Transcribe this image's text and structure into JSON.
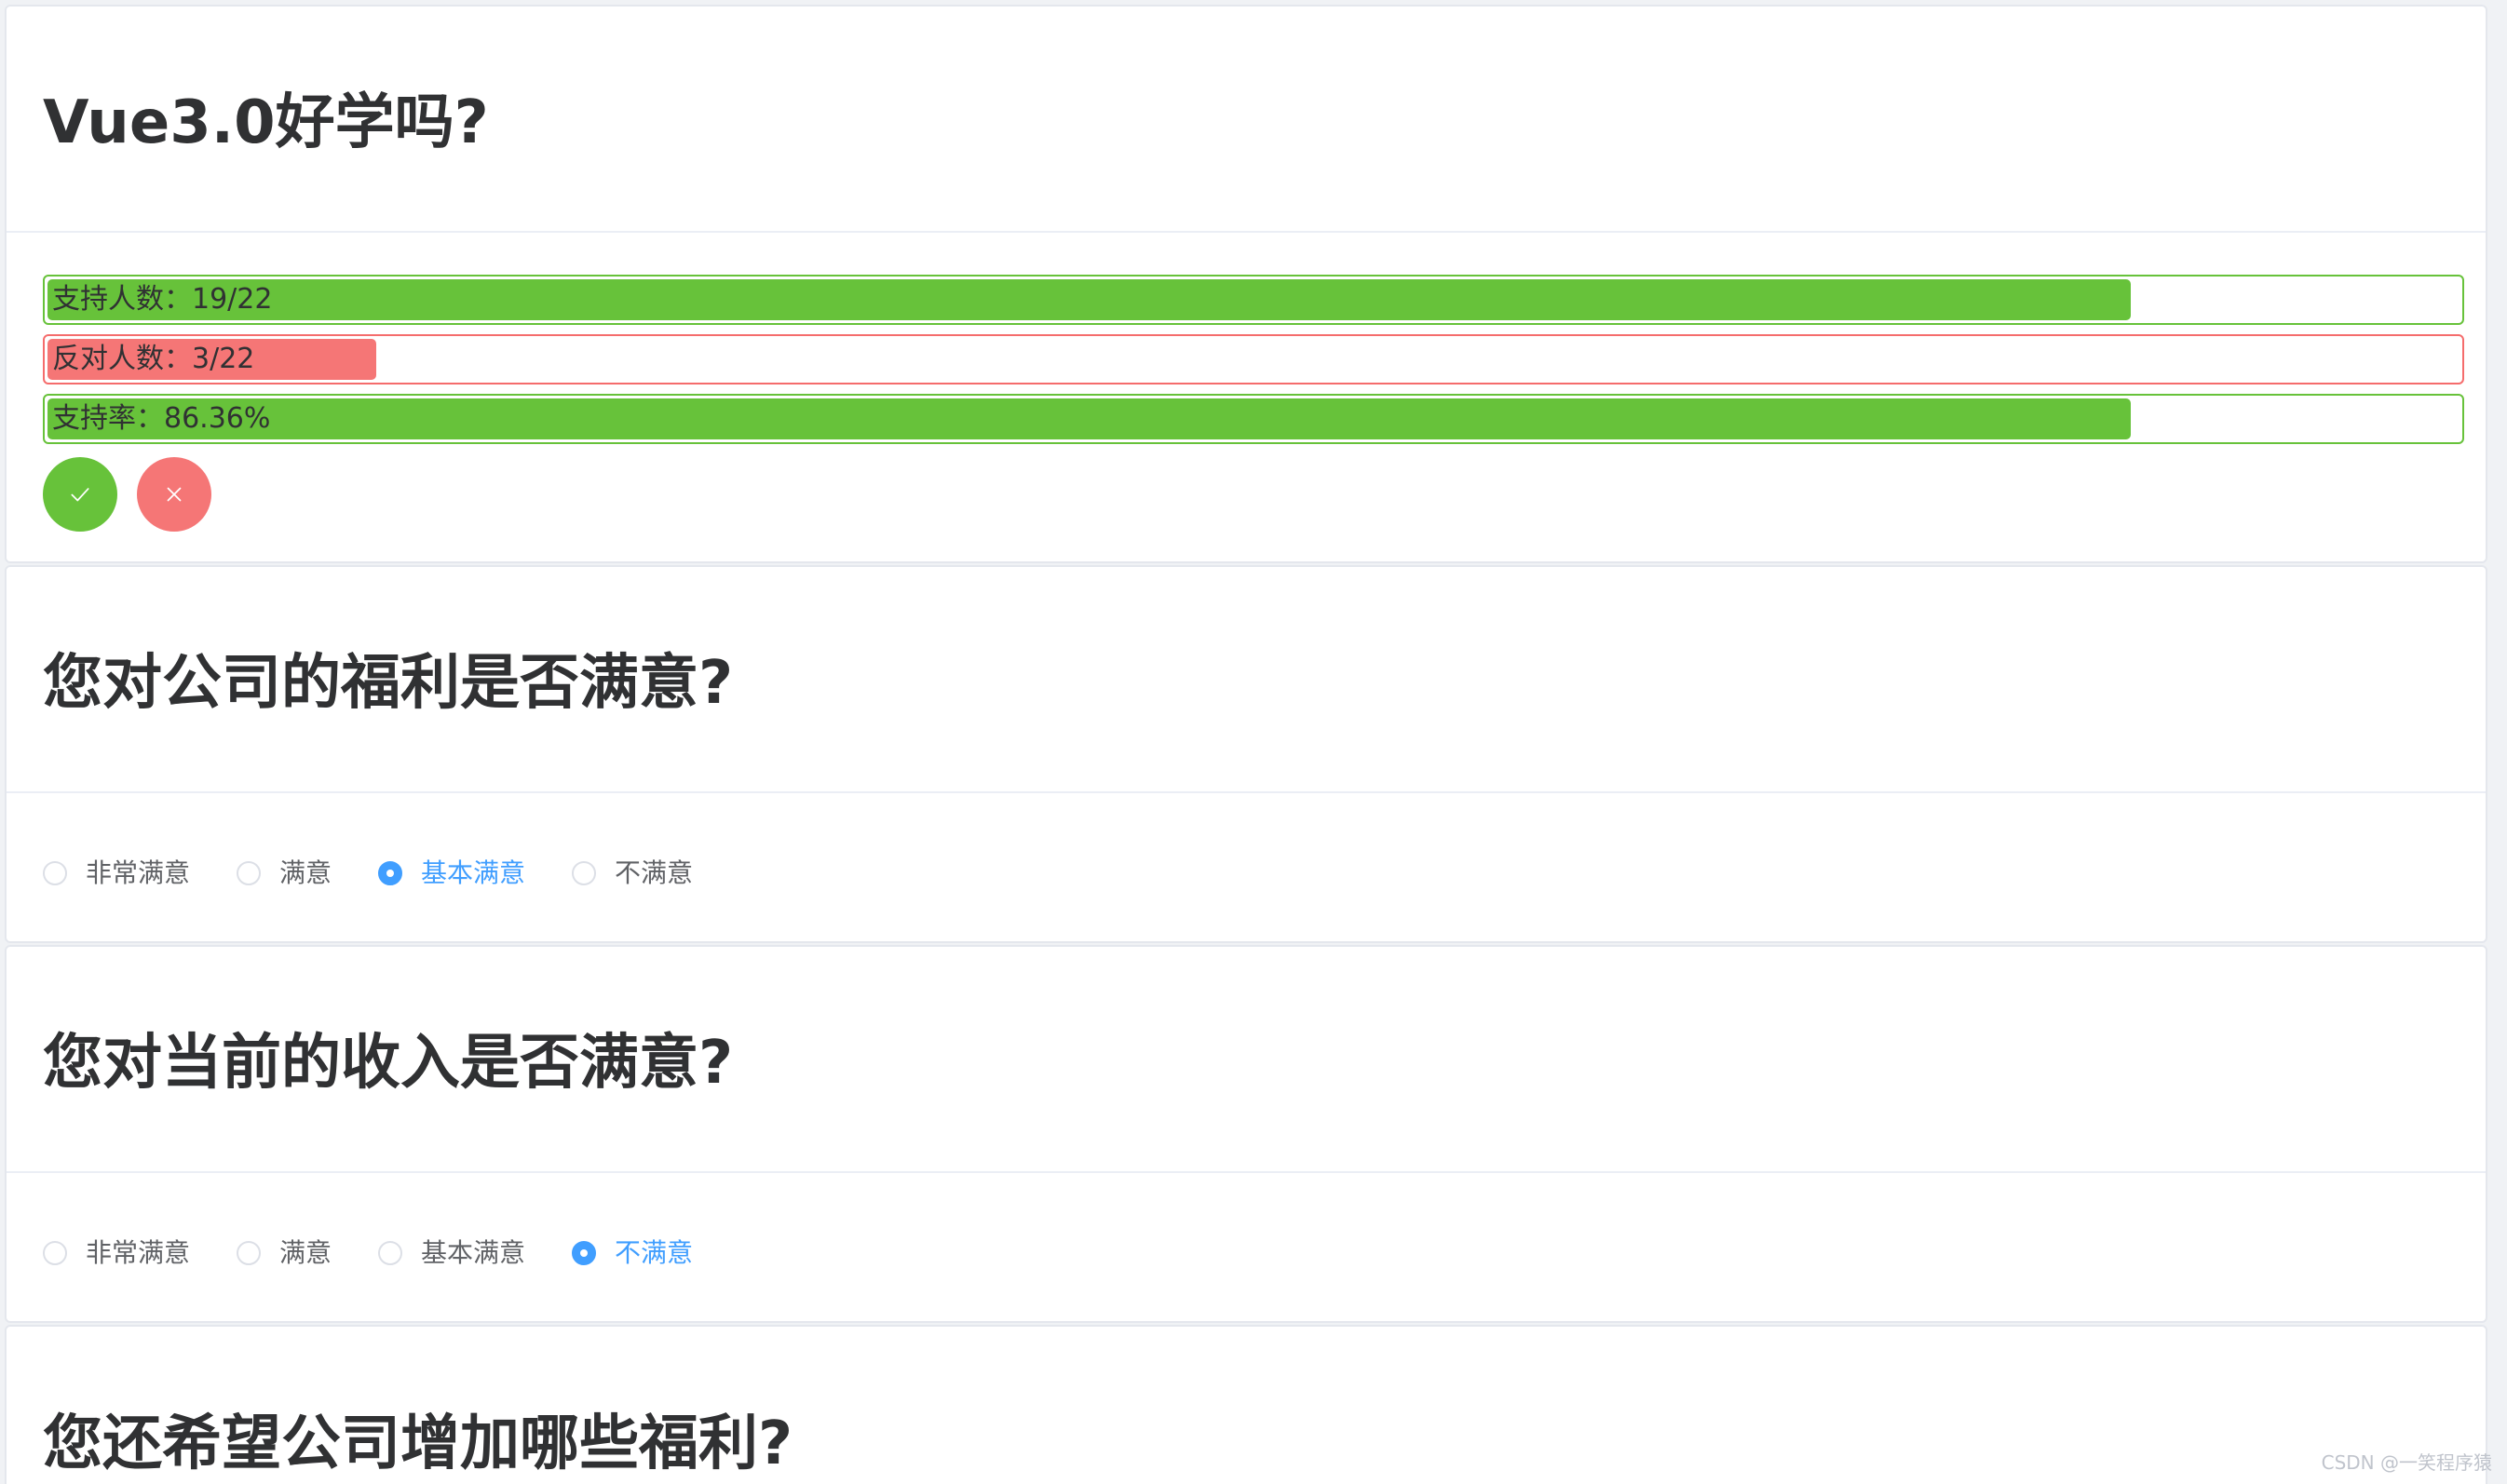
{
  "polls": [
    {
      "title": "Vue3.0好学吗?",
      "bars": [
        {
          "text": "支持人数：19/22",
          "value": 19,
          "total": 22,
          "fill_fraction": 0.8636,
          "status": "success"
        },
        {
          "text": "反对人数：3/22",
          "value": 3,
          "total": 22,
          "fill_fraction": 0.1364,
          "status": "danger"
        },
        {
          "text": "支持率：86.36%",
          "percent": 86.36,
          "fill_fraction": 0.8636,
          "status": "success"
        }
      ],
      "buttons": {
        "approve_icon": "check-icon",
        "reject_icon": "close-icon"
      }
    },
    {
      "title": "您对公司的福利是否满意?",
      "options": [
        "非常满意",
        "满意",
        "基本满意",
        "不满意"
      ],
      "selected": "基本满意"
    },
    {
      "title": "您对当前的收入是否满意?",
      "options": [
        "非常满意",
        "满意",
        "基本满意",
        "不满意"
      ],
      "selected": "不满意"
    },
    {
      "title": "您还希望公司增加哪些福利?"
    }
  ],
  "watermark": "CSDN @一笑程序猿",
  "colors": {
    "success": "#67c23a",
    "danger": "#f56c6c",
    "danger_fill": "#f57676",
    "primary": "#409eff",
    "text": "#303133",
    "muted": "#606266"
  }
}
